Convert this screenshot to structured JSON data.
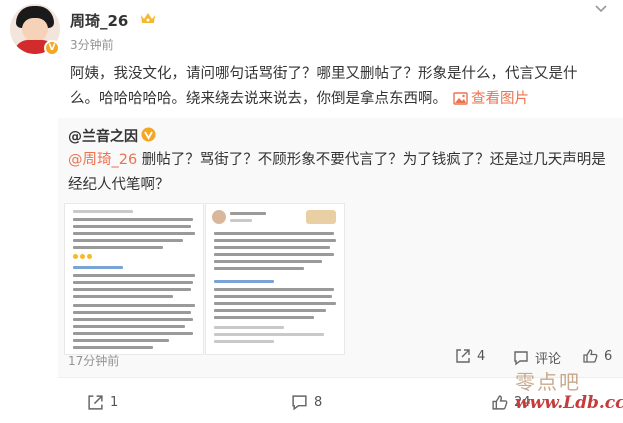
{
  "post": {
    "username": "周琦_26",
    "timestamp": "3分钟前",
    "text": "阿姨，我没文化，请问哪句话骂街了？哪里又删帖了？形象是什么，代言又是什么。哈哈哈哈哈。绕来绕去说来说去，你倒是拿点东西啊。",
    "view_pictures_label": "查看图片",
    "avatar_badge": "V"
  },
  "quote": {
    "author": "@兰音之因",
    "mention": "@周琦_26",
    "text": " 删帖了？骂街了？不顾形象不要代言了？为了钱疯了？还是过几天声明是经纪人代笔啊？",
    "timestamp": "17分钟前",
    "stats": {
      "shares": "4",
      "comment_label": "评论",
      "likes": "6"
    }
  },
  "actions": {
    "shares": "1",
    "comments": "8",
    "likes": "24"
  },
  "watermark": {
    "name": "零点吧",
    "url": "www.Ldb.cc"
  },
  "colors": {
    "accent": "#eb7350",
    "quote_bg": "#f9f9f9",
    "muted": "#939393"
  },
  "icons": [
    "more-icon",
    "vip-crown-icon",
    "image-icon",
    "verified-badge-icon",
    "share-icon",
    "comment-icon",
    "like-icon"
  ]
}
